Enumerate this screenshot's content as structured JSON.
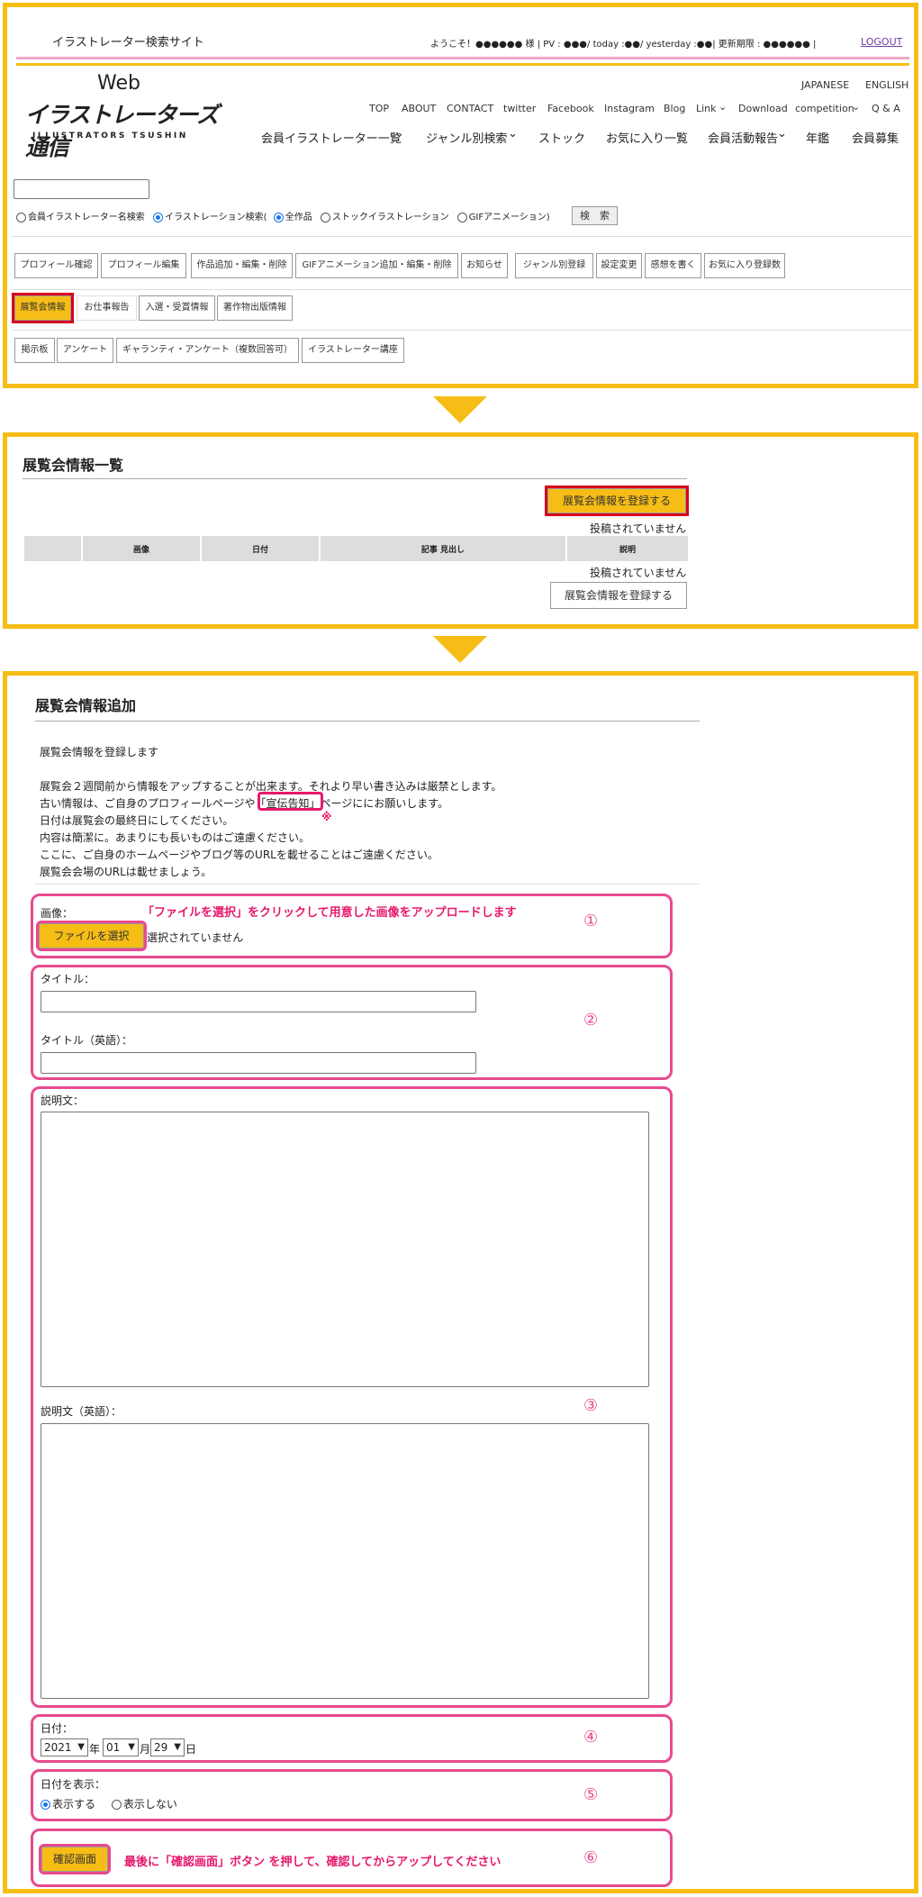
{
  "header": {
    "site_desc": "イラストレーター検索サイト",
    "status": "ようこそ！●●●●●● 様 | PV : ●●●/ today :●●/ yesterday :●●| 更新期限 : ●●●●●● |",
    "logout": "LOGOUT",
    "logo_web": "Web",
    "logo_main": "イラストレーターズ通信",
    "logo_sub": "ILLUSTRATORS TSUSHIN",
    "lang_ja": "JAPANESE",
    "lang_en": "ENGLISH",
    "nav": [
      "TOP",
      "ABOUT",
      "CONTACT",
      "twitter",
      "Facebook",
      "Instagram",
      "Blog",
      "Link",
      "Download",
      "competition",
      "Q & A"
    ],
    "menu": [
      "会員イラストレーター一覧",
      "ジャンル別検索",
      "ストック",
      "お気に入り一覧",
      "会員活動報告",
      "年鑑",
      "会員募集"
    ]
  },
  "search": {
    "opt_member": "会員イラストレーター名検索",
    "opt_illust": "イラストレーション検索(",
    "opt_all": "全作品",
    "opt_stock": "ストックイラストレーション",
    "opt_gif": "GIFアニメーション)",
    "button": "検　索"
  },
  "toolbar": {
    "row1": [
      "プロフィール確認",
      "プロフィール編集",
      "作品追加・編集・削除",
      "GIFアニメーション追加・編集・削除",
      "お知らせ",
      "ジャンル別登録",
      "設定変更",
      "感想を書く",
      "お気に入り登録数"
    ],
    "row2": [
      "展覧会情報",
      "お仕事報告",
      "入選・受賞情報",
      "著作物出版情報"
    ],
    "row3": [
      "掲示板",
      "アンケート",
      "ギャランティ・アンケート（複数回答可）",
      "イラストレーター講座"
    ]
  },
  "list": {
    "title": "展覧会情報一覧",
    "register": "展覧会情報を登録する",
    "empty": "投稿されていません",
    "columns": [
      "",
      "画像",
      "日付",
      "記事 見出し",
      "説明"
    ]
  },
  "form": {
    "title": "展覧会情報追加",
    "intro": [
      "展覧会情報を登録します",
      "",
      "展覧会２週間前から情報をアップすることが出来ます。それより早い書き込みは厳禁とします。",
      "古い情報は、ご自身のプロフィールページや「宣伝告知」ページににお願いします。",
      "日付は展覧会の最終日にしてください。",
      "内容は簡潔に。あまりにも長いものはご遠慮ください。",
      "ここに、ご自身のホームページやブログ等のURLを載せることはご遠慮ください。",
      "展覧会会場のURLは載せましょう。"
    ],
    "note_mark": "※",
    "image_label": "画像：",
    "file_button": "ファイルを選択",
    "file_status": "選択されていません",
    "image_hint": "「ファイルを選択」をクリックして用意した画像をアップロードします",
    "title_label": "タイトル：",
    "title_en_label": "タイトル（英語）：",
    "desc_label": "説明文：",
    "desc_en_label": "説明文（英語）：",
    "date_label": "日付：",
    "year": "2021",
    "year_unit": "年",
    "month": "01",
    "month_unit": "月",
    "day": "29",
    "day_unit": "日",
    "show_date_label": "日付を表示：",
    "show_yes": "表示する",
    "show_no": "表示しない",
    "confirm_button": "確認画面",
    "confirm_hint": "最後に「確認画面」ボタン を押して、確認してからアップしてください",
    "steps": [
      "①",
      "②",
      "③",
      "④",
      "⑤",
      "⑥"
    ]
  }
}
